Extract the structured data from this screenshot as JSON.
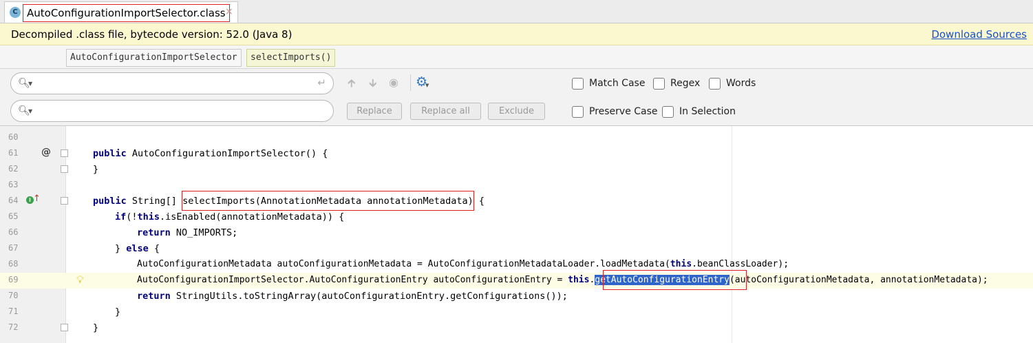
{
  "tab": {
    "icon_letter": "C",
    "title": "AutoConfigurationImportSelector.class",
    "close": "×"
  },
  "notice": {
    "text": "Decompiled .class file, bytecode version: 52.0 (Java 8)",
    "link": "Download Sources"
  },
  "breadcrumbs": [
    "AutoConfigurationImportSelector",
    "selectImports()"
  ],
  "find": {
    "search_value": "",
    "replace_value": "",
    "buttons": {
      "replace": "Replace",
      "replace_all": "Replace all",
      "exclude": "Exclude"
    },
    "options": {
      "match_case": "Match Case",
      "regex": "Regex",
      "words": "Words",
      "preserve_case": "Preserve Case",
      "in_selection": "In Selection"
    }
  },
  "editor": {
    "lines": [
      {
        "n": "60",
        "code": ""
      },
      {
        "n": "61",
        "code": "public AutoConfigurationImportSelector() {"
      },
      {
        "n": "62",
        "code": "}"
      },
      {
        "n": "63",
        "code": ""
      },
      {
        "n": "64",
        "code": "public String[] selectImports(AnnotationMetadata annotationMetadata) {"
      },
      {
        "n": "65",
        "code": "if(!this.isEnabled(annotationMetadata)) {"
      },
      {
        "n": "66",
        "code": "return NO_IMPORTS;"
      },
      {
        "n": "67",
        "code": "} else {"
      },
      {
        "n": "68",
        "code": "AutoConfigurationMetadata autoConfigurationMetadata = AutoConfigurationMetadataLoader.loadMetadata(this.beanClassLoader);"
      },
      {
        "n": "69",
        "code": "AutoConfigurationImportSelector.AutoConfigurationEntry autoConfigurationEntry = this.getAutoConfigurationEntry(autoConfigurationMetadata, annotationMetadata);"
      },
      {
        "n": "70",
        "code": "return StringUtils.toStringArray(autoConfigurationEntry.getConfigurations());"
      },
      {
        "n": "71",
        "code": "}"
      },
      {
        "n": "72",
        "code": "}"
      }
    ],
    "line61": {
      "kw": "public",
      "rest": " AutoConfigurationImportSelector() {"
    },
    "line64": {
      "kw": "public",
      "mid": " String[] ",
      "sig": "selectImports(AnnotationMetadata annotationMetadata)",
      "end": " {"
    },
    "line65": {
      "kw1": "if",
      "p1": "(!",
      "kw2": "this",
      "rest": ".isEnabled(annotationMetadata)) {"
    },
    "line66": {
      "kw": "return",
      "rest": " NO_IMPORTS;"
    },
    "line67": {
      "pre": "} ",
      "kw": "else",
      "rest": " {"
    },
    "line68": {
      "pre": "AutoConfigurationMetadata autoConfigurationMetadata = AutoConfigurationMetadataLoader.loadMetadata(",
      "kw": "this",
      "rest": ".beanClassLoader);"
    },
    "line69": {
      "pre": "AutoConfigurationImportSelector.AutoConfigurationEntry autoConfigurationEntry = ",
      "kw": "this",
      "dot": ".",
      "sel": "getAutoConfigurationEntry",
      "rest": "(autoConfigurationMetadata, annotationMetadata);"
    },
    "line70": {
      "kw": "return",
      "rest": " StringUtils.toStringArray(autoConfigurationEntry.getConfigurations());"
    },
    "brace": "}"
  }
}
